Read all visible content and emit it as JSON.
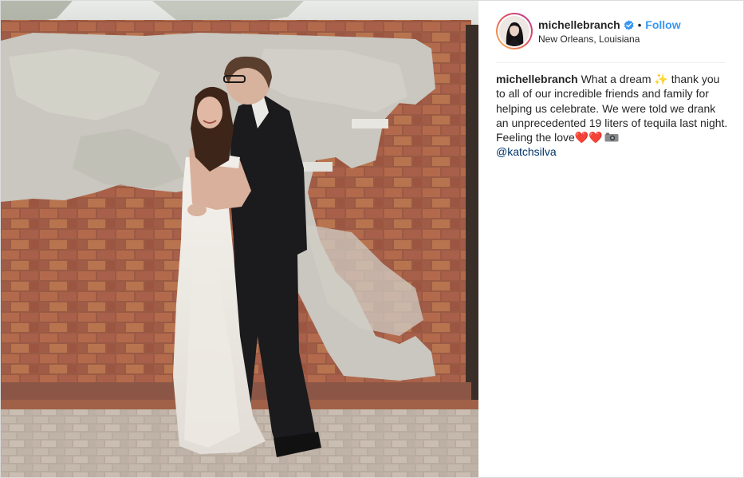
{
  "post": {
    "username": "michellebranch",
    "verified": true,
    "separator": "•",
    "follow_label": "Follow",
    "location": "New Orleans, Louisiana"
  },
  "caption": {
    "username": "michellebranch",
    "text_part1": "What a dream",
    "sparkle": "✨",
    "text_part2": "thank you to all of our incredible friends and family for helping us celebrate. We were told we drank an unprecedented 19 liters of tequila last night. Feeling the love",
    "hearts": "❤️❤️",
    "mention": "@katchsilva"
  },
  "icons": {
    "verified": "verified-badge-icon",
    "camera": "camera-icon"
  },
  "colors": {
    "follow_blue": "#3897f0",
    "verified_blue": "#3897f0",
    "mention": "#003569",
    "text": "#262626",
    "border": "#dbdbdb"
  }
}
